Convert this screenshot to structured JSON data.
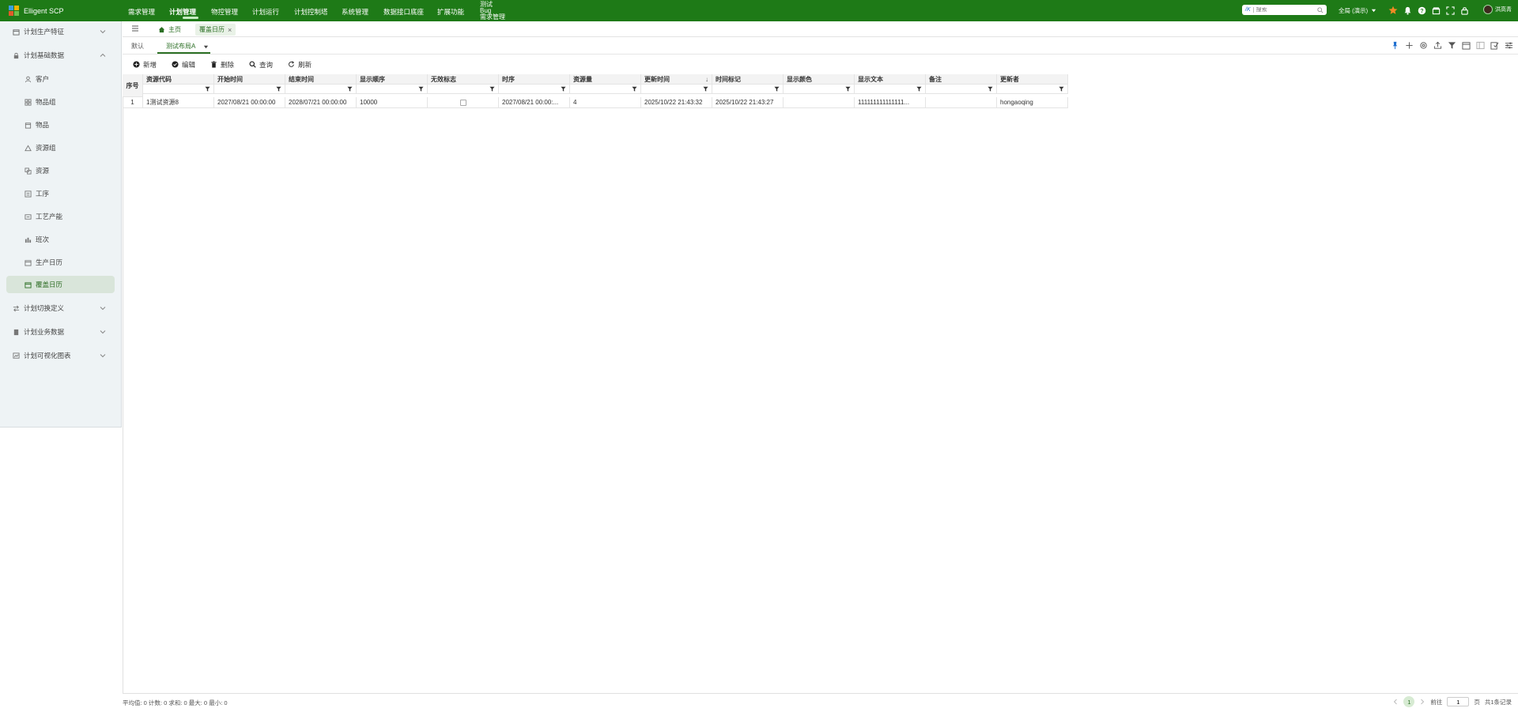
{
  "app": {
    "name": "Elligent SCP"
  },
  "topnav": {
    "items": [
      "需求管理",
      "计划管理",
      "物控管理",
      "计划运行",
      "计划控制塔",
      "系统管理",
      "数据接口底座",
      "扩展功能"
    ],
    "active_index": 1,
    "stacked": [
      "测试",
      "Bug",
      "需求管理"
    ]
  },
  "search": {
    "kbd": "/K",
    "placeholder": "搜索"
  },
  "org": {
    "label": "全局 (演示)"
  },
  "user": {
    "name": "洪高青"
  },
  "sidebar": {
    "items": [
      {
        "label": "计划生产特征",
        "level": 1,
        "icon": "calendar-icon",
        "chevron": "down"
      },
      {
        "label": "计划基础数据",
        "level": 1,
        "icon": "lock-icon",
        "chevron": "up"
      },
      {
        "label": "客户",
        "level": 2,
        "icon": "user-icon"
      },
      {
        "label": "物品组",
        "level": 2,
        "icon": "grid-icon"
      },
      {
        "label": "物品",
        "level": 2,
        "icon": "box-icon"
      },
      {
        "label": "资源组",
        "level": 2,
        "icon": "triangle-icon"
      },
      {
        "label": "资源",
        "level": 2,
        "icon": "resource-icon"
      },
      {
        "label": "工序",
        "level": 2,
        "icon": "process-icon"
      },
      {
        "label": "工艺产能",
        "level": 2,
        "icon": "capacity-icon"
      },
      {
        "label": "班次",
        "level": 2,
        "icon": "bar-chart-icon"
      },
      {
        "label": "生产日历",
        "level": 2,
        "icon": "calendar-icon"
      },
      {
        "label": "覆盖日历",
        "level": 2,
        "icon": "calendar-icon",
        "selected": true
      },
      {
        "label": "计划切换定义",
        "level": 1,
        "icon": "switch-icon",
        "chevron": "down"
      },
      {
        "label": "计划业务数据",
        "level": 1,
        "icon": "database-icon",
        "chevron": "down"
      },
      {
        "label": "计划可视化图表",
        "level": 1,
        "icon": "chart-icon",
        "chevron": "down"
      }
    ]
  },
  "tabs": {
    "home": "主页",
    "current": "覆盖日历"
  },
  "layouts": {
    "default": "默认",
    "active": "测试布局A"
  },
  "actions": {
    "add": "新增",
    "edit": "编辑",
    "delete": "删除",
    "query": "查询",
    "refresh": "刷新"
  },
  "grid": {
    "index_header": "序号",
    "columns": [
      "资源代码",
      "开始时间",
      "结束时间",
      "显示顺序",
      "无效标志",
      "时序",
      "资源量",
      "更新时间",
      "时间标记",
      "显示颜色",
      "显示文本",
      "备注",
      "更新者"
    ],
    "sort_indicator": "↓",
    "rows": [
      {
        "index": "1",
        "cells": [
          "1测试资源8",
          "2027/08/21 00:00:00",
          "2028/07/21 00:00:00",
          "10000",
          "",
          "2027/08/21 00:00:...",
          "4",
          "2025/10/22 21:43:32",
          "2025/10/22 21:43:27",
          "",
          "111111111111111...",
          "",
          "hongaoqing"
        ]
      }
    ]
  },
  "footer": {
    "stats": "平均值: 0 计数: 0 求和: 0 最大: 0 最小: 0",
    "page": "1",
    "goto_label": "前往",
    "goto_value": "1",
    "page_suffix": "页",
    "total": "共1条记录"
  },
  "colors": {
    "topbar": "#1e7a17",
    "accent": "#2b6f24",
    "sidebar_bg": "#eef3f5",
    "selected_bg": "#d9e5da"
  }
}
